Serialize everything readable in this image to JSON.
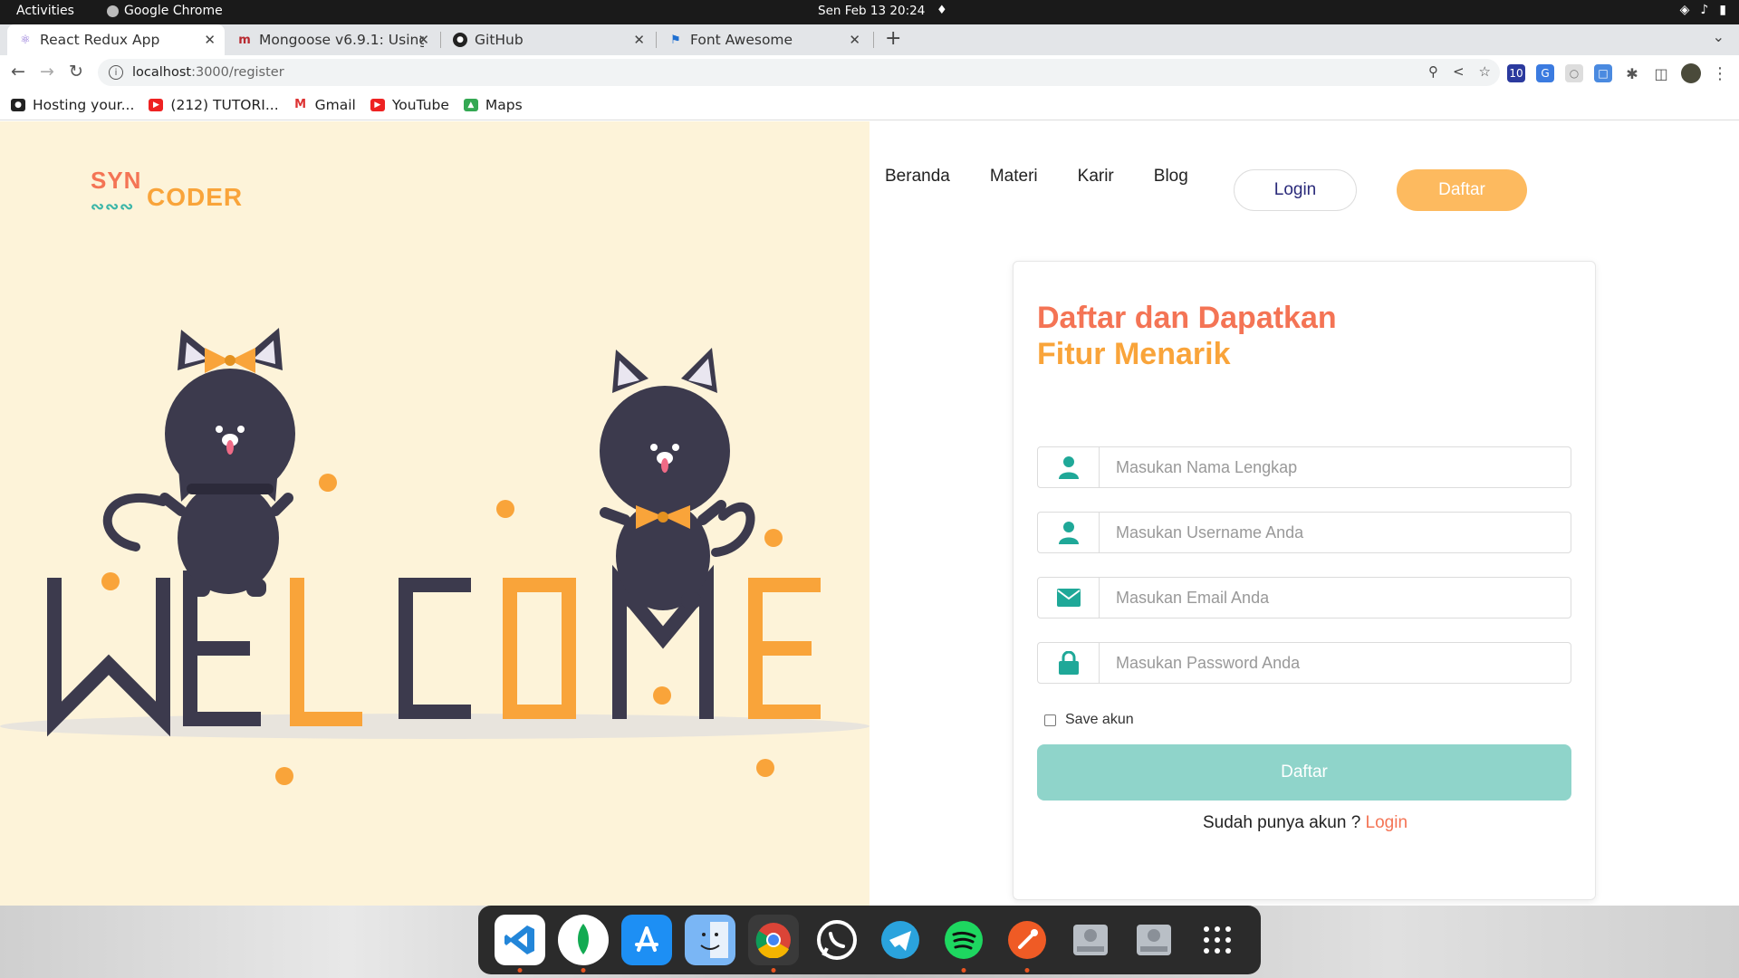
{
  "system_bar": {
    "activities": "Activities",
    "app_name": "Google Chrome",
    "clock": "Sen Feb 13  20:24"
  },
  "browser": {
    "tabs": [
      {
        "title": "React Redux App",
        "active": true
      },
      {
        "title": "Mongoose v6.9.1: Using",
        "active": false
      },
      {
        "title": "GitHub",
        "active": false
      },
      {
        "title": "Font Awesome",
        "active": false
      }
    ],
    "url_host": "localhost",
    "url_path": ":3000/register",
    "bookmarks": [
      {
        "label": "Hosting your..."
      },
      {
        "label": "(212) TUTORI..."
      },
      {
        "label": "Gmail"
      },
      {
        "label": "YouTube"
      },
      {
        "label": "Maps"
      }
    ]
  },
  "site": {
    "logo_syn": "SYN",
    "logo_coder": "CODER",
    "nav": [
      "Beranda",
      "Materi",
      "Karir",
      "Blog"
    ],
    "login_button": "Login",
    "register_button": "Daftar",
    "hero_word": "WELCOME"
  },
  "form": {
    "heading_line1": "Daftar dan Dapatkan",
    "heading_line2": "Fitur Menarik",
    "fields": [
      {
        "placeholder": "Masukan Nama Lengkap",
        "icon": "user-icon"
      },
      {
        "placeholder": "Masukan Username Anda",
        "icon": "user-icon"
      },
      {
        "placeholder": "Masukan Email Anda",
        "icon": "envelope-icon"
      },
      {
        "placeholder": "Masukan Password Anda",
        "icon": "lock-icon"
      }
    ],
    "save_label": "Save akun",
    "submit_label": "Daftar",
    "have_account": "Sudah punya akun ?",
    "login_link": "Login"
  },
  "colors": {
    "brand_orange": "#f47455",
    "brand_yellow": "#f9a43a",
    "accent_teal": "#3cb6a8",
    "submit_teal": "#8fd4ca",
    "hero_bg": "#fdf3d9",
    "cat_dark": "#3c3a4d"
  }
}
